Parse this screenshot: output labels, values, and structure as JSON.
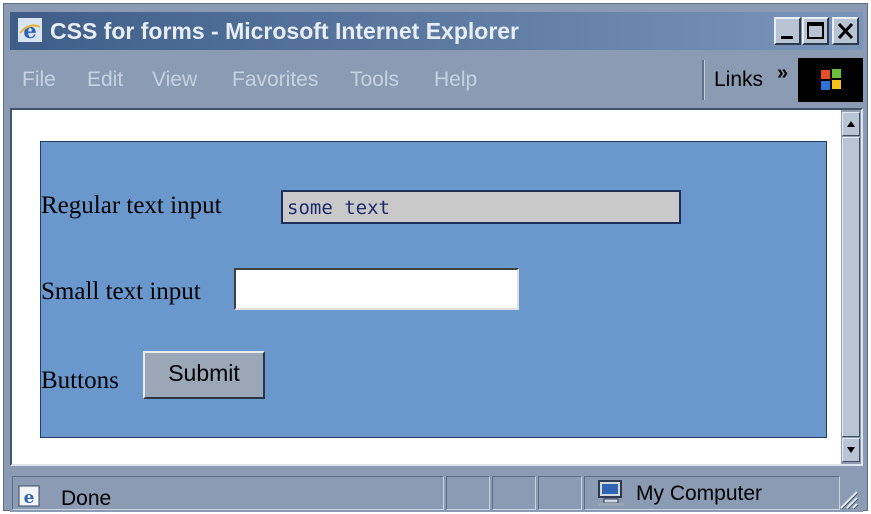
{
  "window": {
    "title": "CSS for forms - Microsoft Internet Explorer",
    "controls": [
      "minimize",
      "maximize",
      "close"
    ]
  },
  "menubar": {
    "items": [
      {
        "label": "File"
      },
      {
        "label": "Edit"
      },
      {
        "label": "View"
      },
      {
        "label": "Favorites"
      },
      {
        "label": "Tools"
      },
      {
        "label": "Help"
      }
    ],
    "links_label": "Links",
    "links_chevron": "»"
  },
  "form": {
    "regular_label": "Regular text input",
    "regular_value": "some text",
    "small_label": "Small text input",
    "small_value": "",
    "buttons_label": "Buttons",
    "submit_label": "Submit"
  },
  "status": {
    "text": "Done",
    "zone": "My Computer"
  },
  "colors": {
    "form_panel_bg": "#6a98cd",
    "chrome": "#8a9bb3",
    "title_gradient_start": "#3e5e89"
  }
}
